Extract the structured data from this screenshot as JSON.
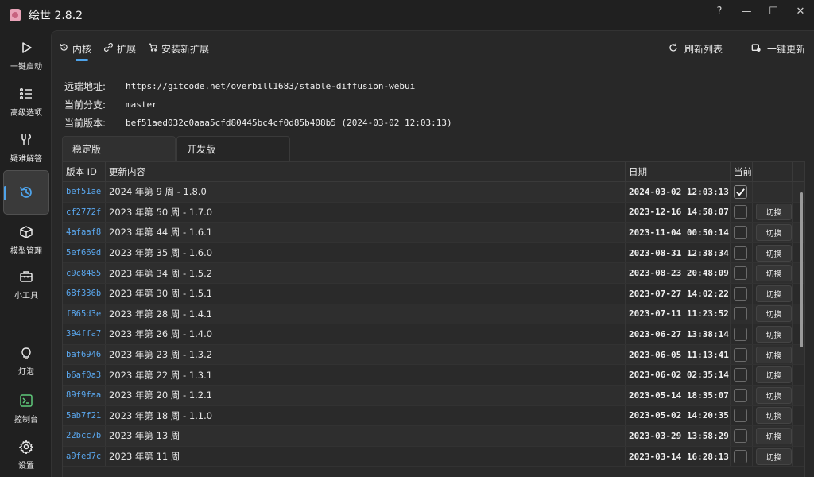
{
  "app": {
    "title": "绘世 2.8.2"
  },
  "window_controls": [
    "?",
    "—",
    "☐",
    "✕"
  ],
  "sidebar": {
    "items": [
      {
        "label": "一键启动",
        "icon": "play-icon"
      },
      {
        "label": "高级选项",
        "icon": "list-settings-icon"
      },
      {
        "label": "疑难解答",
        "icon": "wrench-icon"
      },
      {
        "label": "",
        "icon": "history-icon",
        "active": true
      },
      {
        "label": "模型管理",
        "icon": "cube-icon"
      },
      {
        "label": "小工具",
        "icon": "toolbox-icon"
      },
      {
        "label": "灯泡",
        "icon": "lightbulb-icon"
      },
      {
        "label": "控制台",
        "icon": "console-icon"
      },
      {
        "label": "设置",
        "icon": "gear-icon"
      }
    ]
  },
  "tabs": [
    {
      "label": "内核",
      "icon": "history-icon",
      "active": true
    },
    {
      "label": "扩展",
      "icon": "plug-icon"
    },
    {
      "label": "安装新扩展",
      "icon": "cart-icon"
    }
  ],
  "toolbar": {
    "refresh_label": "刷新列表",
    "update_label": "一键更新"
  },
  "info": {
    "remote_label": "远端地址:",
    "remote_value": "https://gitcode.net/overbill1683/stable-diffusion-webui",
    "branch_label": "当前分支:",
    "branch_value": "master",
    "version_label": "当前版本:",
    "version_value": "bef51aed032c0aaa5cfd80445bc4cf0d85b408b5 (2024-03-02 12:03:13)"
  },
  "branch_tabs": [
    "稳定版",
    "开发版"
  ],
  "table": {
    "headers": {
      "id": "版本 ID",
      "msg": "更新内容",
      "date": "日期",
      "current": "当前"
    },
    "switch_label": "切换",
    "rows": [
      {
        "id": "bef51ae",
        "msg": "2024 年第 9 周 - 1.8.0",
        "date": "2024-03-02 12:03:13",
        "current": true
      },
      {
        "id": "cf2772f",
        "msg": "2023 年第 50 周 - 1.7.0",
        "date": "2023-12-16 14:58:07",
        "current": false
      },
      {
        "id": "4afaaf8",
        "msg": "2023 年第 44 周 - 1.6.1",
        "date": "2023-11-04 00:50:14",
        "current": false
      },
      {
        "id": "5ef669d",
        "msg": "2023 年第 35 周 - 1.6.0",
        "date": "2023-08-31 12:38:34",
        "current": false
      },
      {
        "id": "c9c8485",
        "msg": "2023 年第 34 周 - 1.5.2",
        "date": "2023-08-23 20:48:09",
        "current": false
      },
      {
        "id": "68f336b",
        "msg": "2023 年第 30 周 - 1.5.1",
        "date": "2023-07-27 14:02:22",
        "current": false
      },
      {
        "id": "f865d3e",
        "msg": "2023 年第 28 周 - 1.4.1",
        "date": "2023-07-11 11:23:52",
        "current": false
      },
      {
        "id": "394ffa7",
        "msg": "2023 年第 26 周 - 1.4.0",
        "date": "2023-06-27 13:38:14",
        "current": false
      },
      {
        "id": "baf6946",
        "msg": "2023 年第 23 周 - 1.3.2",
        "date": "2023-06-05 11:13:41",
        "current": false
      },
      {
        "id": "b6af0a3",
        "msg": "2023 年第 22 周 - 1.3.1",
        "date": "2023-06-02 02:35:14",
        "current": false
      },
      {
        "id": "89f9faa",
        "msg": "2023 年第 20 周 - 1.2.1",
        "date": "2023-05-14 18:35:07",
        "current": false
      },
      {
        "id": "5ab7f21",
        "msg": "2023 年第 18 周 - 1.1.0",
        "date": "2023-05-02 14:20:35",
        "current": false
      },
      {
        "id": "22bcc7b",
        "msg": "2023 年第 13 周",
        "date": "2023-03-29 13:58:29",
        "current": false
      },
      {
        "id": "a9fed7c",
        "msg": "2023 年第 11 周",
        "date": "2023-03-14 16:28:13",
        "current": false
      }
    ]
  },
  "colors": {
    "accent": "#4ea3ea",
    "id_link": "#5aa7ee"
  }
}
